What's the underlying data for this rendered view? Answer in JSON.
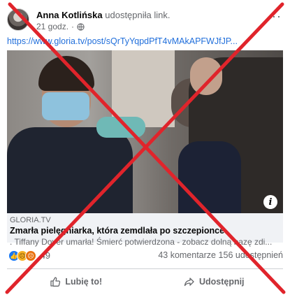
{
  "post": {
    "author": "Anna Kotlińska",
    "action": "udostępniła link.",
    "time": "21 godz.",
    "separator": "·",
    "link_url": "https://www.gloria.tv/post/sQrTyYqpdPfT4vMAkAPFWJfJP..."
  },
  "preview": {
    "image_alt": "nurse receiving vaccine",
    "domain": "GLORIA.TV",
    "title": "Zmarła pielęgniarka, która zemdlała po szczepionce",
    "description": ". Tiffany Dover umarła! Śmierć potwierdzona - zobacz dolną bazę zdi..."
  },
  "stats": {
    "reaction_count": "49",
    "comments": "43 komentarze",
    "shares": "156 udostępnień"
  },
  "actions": {
    "like": "Lubię to!",
    "share": "Udostępnij"
  },
  "colors": {
    "link": "#216fdb",
    "cross": "#e0242b",
    "like_blue": "#1877f2"
  },
  "icons": [
    "globe-icon",
    "more-icon",
    "info-icon",
    "thumbs-up-icon",
    "share-icon"
  ]
}
